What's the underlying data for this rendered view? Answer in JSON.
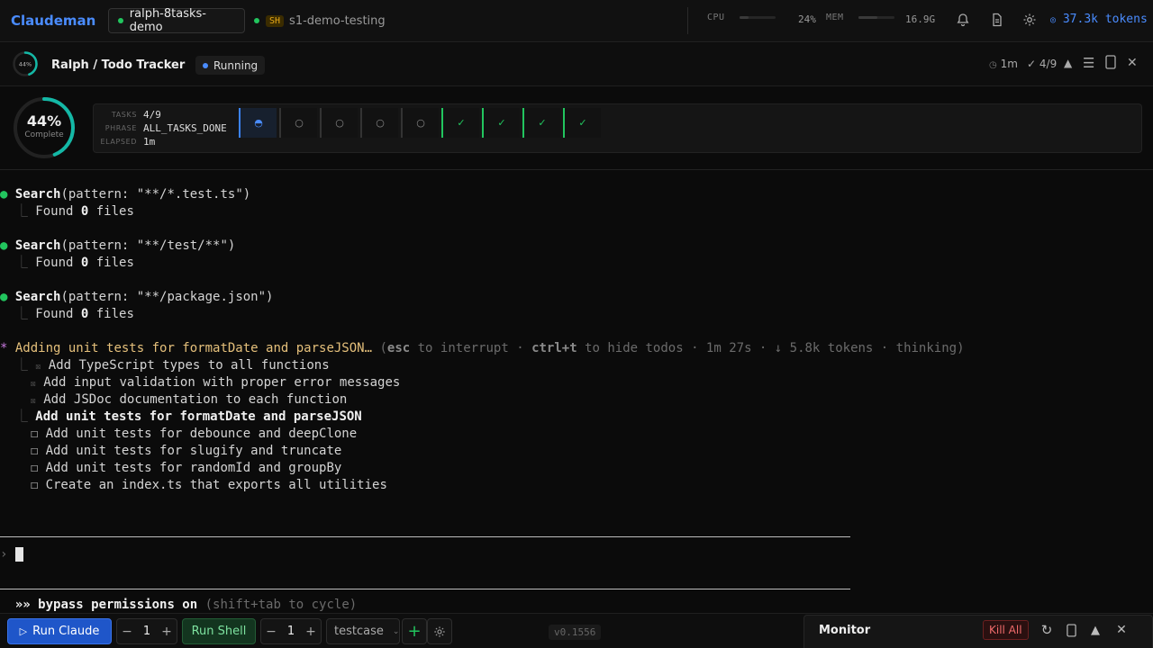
{
  "app": {
    "brand": "Claudeman"
  },
  "tabs": [
    {
      "label": "ralph-8tasks-demo",
      "active": true
    },
    {
      "label": "s1-demo-testing",
      "badge": "SH",
      "active": false
    }
  ],
  "system": {
    "cpu_label": "CPU",
    "cpu_value": "24%",
    "cpu_fraction": 0.24,
    "mem_label": "MEM",
    "mem_value": "16.9G",
    "mem_fraction": 0.53,
    "tokens": "37.3k tokens"
  },
  "ralph": {
    "mini_percent": "44%",
    "title": "Ralph / Todo Tracker",
    "status": "Running",
    "elapsed_short": "1m",
    "tasks_short": "4/9"
  },
  "progress": {
    "percent_value": 0.44,
    "percent": "44%",
    "percent_label": "Complete",
    "tasks_label": "TASKS",
    "tasks_value": "4/9",
    "phrase_label": "PHRASE",
    "phrase_value": "ALL_TASKS_DONE",
    "elapsed_label": "ELAPSED",
    "elapsed_value": "1m",
    "cells": [
      "◓",
      "○",
      "○",
      "○",
      "○",
      "✓",
      "✓",
      "✓",
      "✓"
    ]
  },
  "terminal": {
    "searches": [
      {
        "tool": "Search",
        "args": "(pattern: \"**/*.test.ts\")",
        "found_pre": "Found ",
        "count": "0",
        "found_post": " files"
      },
      {
        "tool": "Search",
        "args": "(pattern: \"**/test/**\")",
        "found_pre": "Found ",
        "count": "0",
        "found_post": " files"
      },
      {
        "tool": "Search",
        "args": "(pattern: \"**/package.json\")",
        "found_pre": "Found ",
        "count": "0",
        "found_post": " files"
      }
    ],
    "activity": {
      "star": "*",
      "text": "Adding unit tests for formatDate and parseJSON…",
      "h1": "(",
      "k1": "esc",
      "h2": " to interrupt · ",
      "k2": "ctrl+t",
      "h3": " to hide todos · 1m 27s · ↓ 5.8k tokens · thinking)"
    },
    "todos_done": [
      "Add TypeScript types to all functions",
      "Add input validation with proper error messages",
      "Add JSDoc documentation to each function"
    ],
    "todo_current": "Add unit tests for formatDate and parseJSON",
    "todos_pending": [
      "Add unit tests for debounce and deepClone",
      "Add unit tests for slugify and truncate",
      "Add unit tests for randomId and groupBy",
      "Create an index.ts that exports all utilities"
    ],
    "prompt": "›",
    "mode_arrows": "»»",
    "mode_text": "bypass permissions on",
    "mode_hint": "(shift+tab to cycle)"
  },
  "bottom": {
    "run_claude": "Run Claude",
    "claude_count": "1",
    "run_shell": "Run Shell",
    "shell_count": "1",
    "case_select": "testcase",
    "version": "v0.1556"
  },
  "monitor": {
    "title": "Monitor",
    "kill_all": "Kill All"
  }
}
